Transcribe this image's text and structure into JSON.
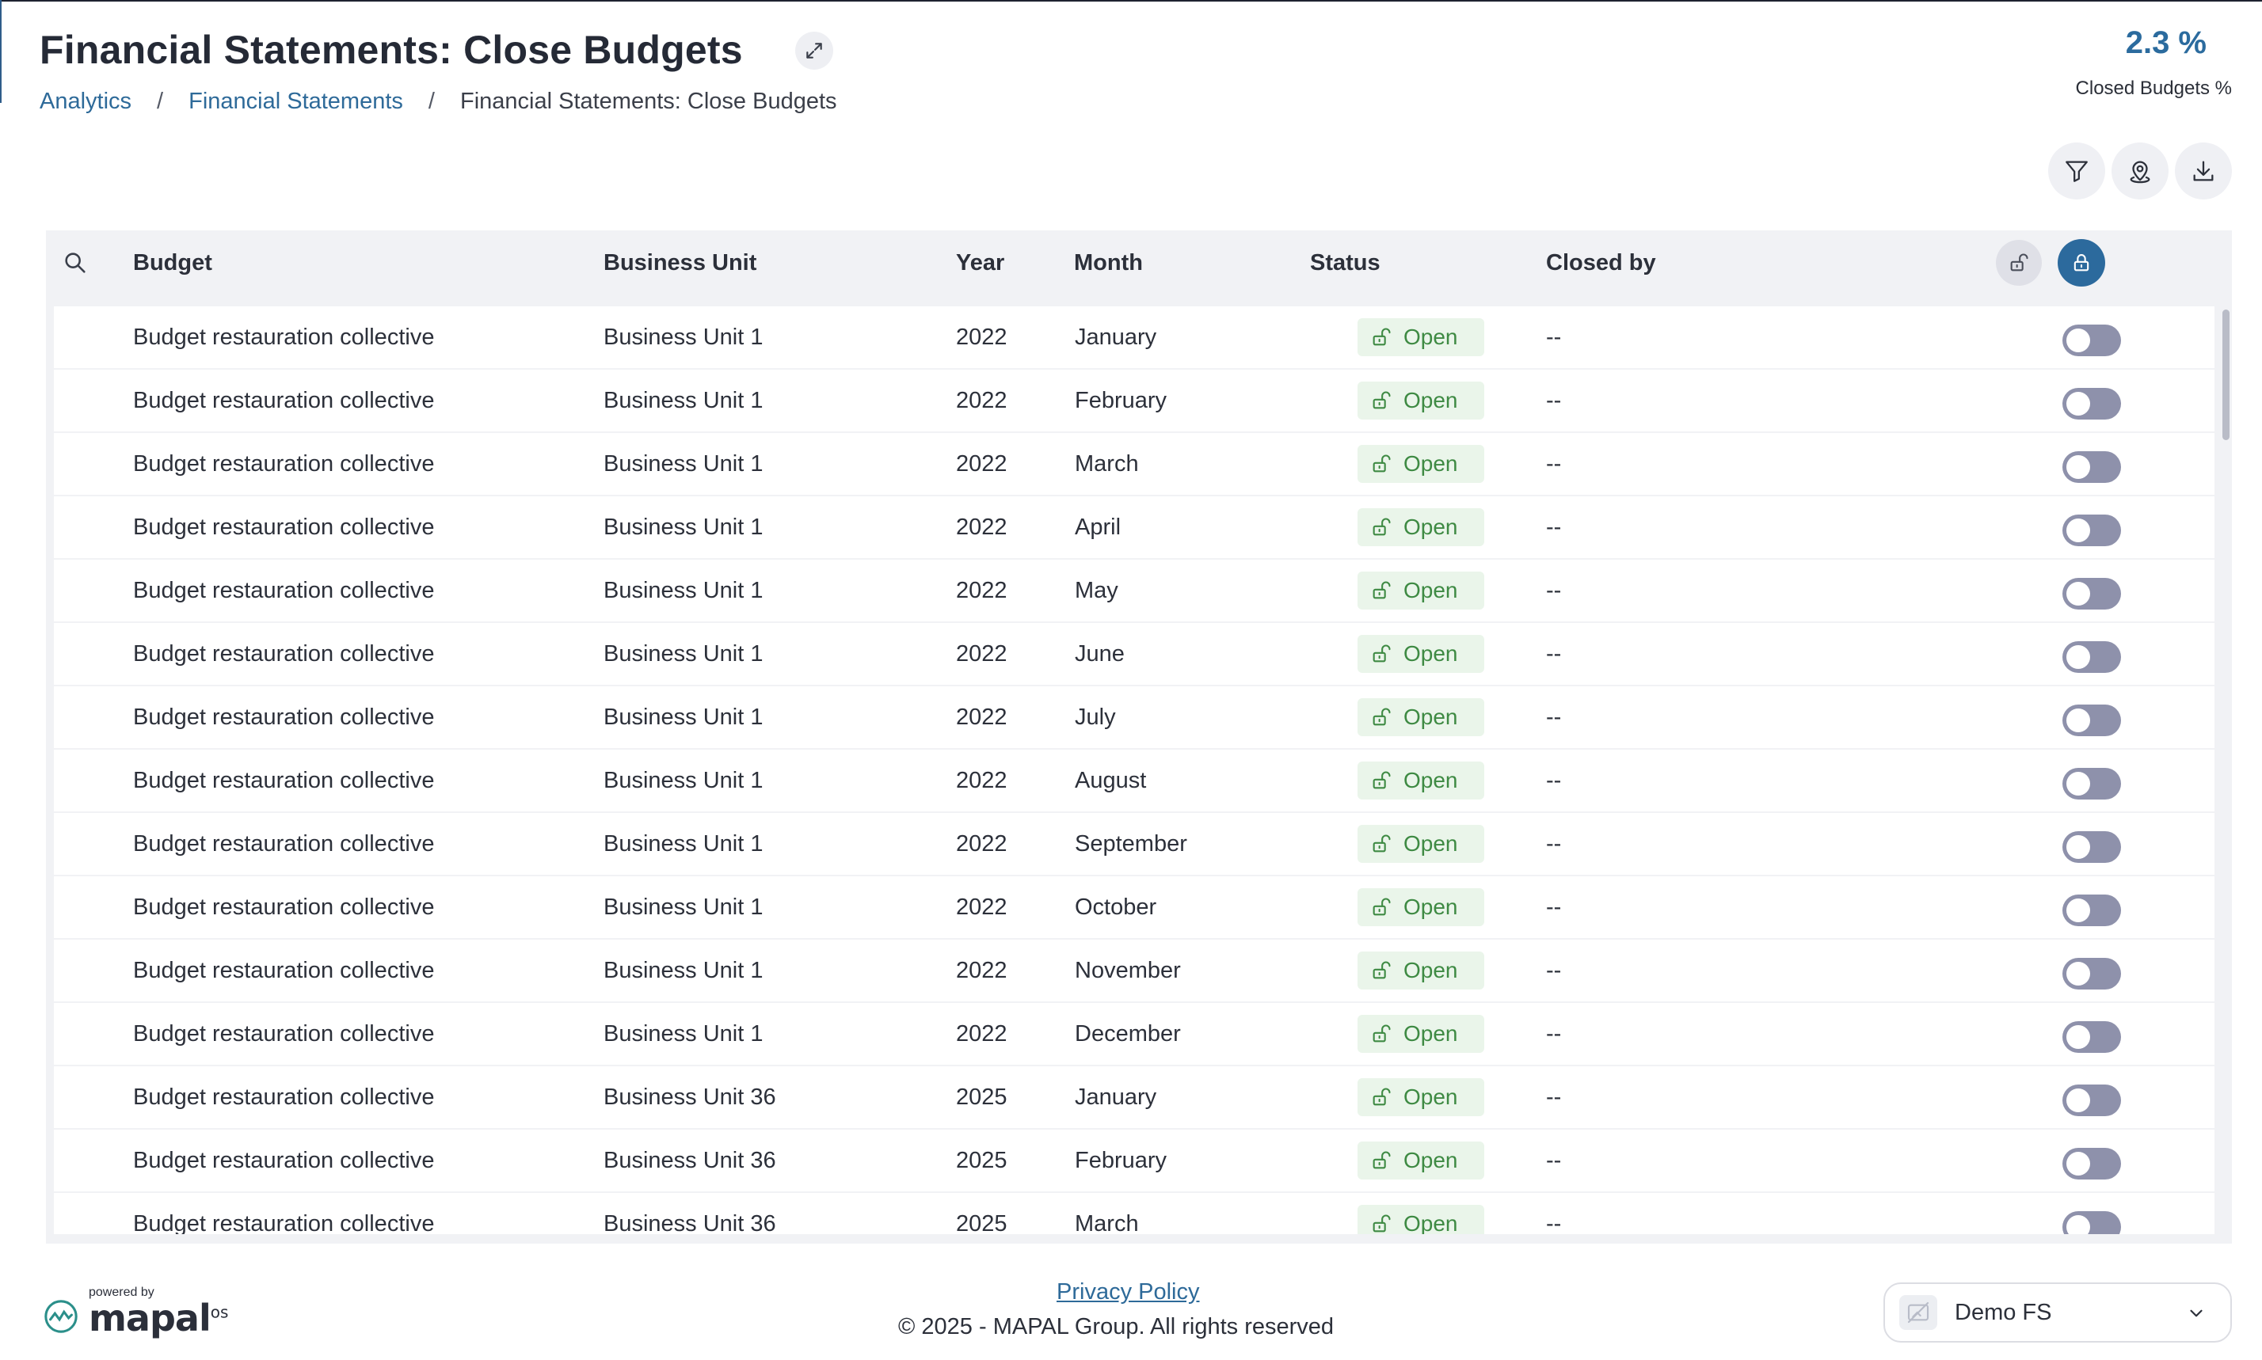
{
  "header": {
    "title": "Financial Statements: Close Budgets",
    "expand_icon": "expand-icon"
  },
  "breadcrumb": [
    {
      "label": "Analytics",
      "link": true
    },
    {
      "label": "Financial Statements",
      "link": true
    },
    {
      "label": "Financial Statements: Close Budgets",
      "link": false
    }
  ],
  "breadcrumb_separator": "/",
  "kpi": {
    "value": "2.3 %",
    "label": "Closed Budgets %"
  },
  "actions": [
    {
      "name": "filter-button",
      "icon": "filter-icon"
    },
    {
      "name": "location-button",
      "icon": "location-pin-icon"
    },
    {
      "name": "download-button",
      "icon": "download-icon"
    }
  ],
  "table": {
    "columns": {
      "budget": "Budget",
      "business_unit": "Business Unit",
      "year": "Year",
      "month": "Month",
      "status": "Status",
      "closed_by": "Closed by"
    },
    "rows": [
      {
        "budget": "Budget restauration collective",
        "business_unit": "Business Unit 1",
        "year": "2022",
        "month": "January",
        "status": "Open",
        "closed_by": "--",
        "closed": false
      },
      {
        "budget": "Budget restauration collective",
        "business_unit": "Business Unit 1",
        "year": "2022",
        "month": "February",
        "status": "Open",
        "closed_by": "--",
        "closed": false
      },
      {
        "budget": "Budget restauration collective",
        "business_unit": "Business Unit 1",
        "year": "2022",
        "month": "March",
        "status": "Open",
        "closed_by": "--",
        "closed": false
      },
      {
        "budget": "Budget restauration collective",
        "business_unit": "Business Unit 1",
        "year": "2022",
        "month": "April",
        "status": "Open",
        "closed_by": "--",
        "closed": false
      },
      {
        "budget": "Budget restauration collective",
        "business_unit": "Business Unit 1",
        "year": "2022",
        "month": "May",
        "status": "Open",
        "closed_by": "--",
        "closed": false
      },
      {
        "budget": "Budget restauration collective",
        "business_unit": "Business Unit 1",
        "year": "2022",
        "month": "June",
        "status": "Open",
        "closed_by": "--",
        "closed": false
      },
      {
        "budget": "Budget restauration collective",
        "business_unit": "Business Unit 1",
        "year": "2022",
        "month": "July",
        "status": "Open",
        "closed_by": "--",
        "closed": false
      },
      {
        "budget": "Budget restauration collective",
        "business_unit": "Business Unit 1",
        "year": "2022",
        "month": "August",
        "status": "Open",
        "closed_by": "--",
        "closed": false
      },
      {
        "budget": "Budget restauration collective",
        "business_unit": "Business Unit 1",
        "year": "2022",
        "month": "September",
        "status": "Open",
        "closed_by": "--",
        "closed": false
      },
      {
        "budget": "Budget restauration collective",
        "business_unit": "Business Unit 1",
        "year": "2022",
        "month": "October",
        "status": "Open",
        "closed_by": "--",
        "closed": false
      },
      {
        "budget": "Budget restauration collective",
        "business_unit": "Business Unit 1",
        "year": "2022",
        "month": "November",
        "status": "Open",
        "closed_by": "--",
        "closed": false
      },
      {
        "budget": "Budget restauration collective",
        "business_unit": "Business Unit 1",
        "year": "2022",
        "month": "December",
        "status": "Open",
        "closed_by": "--",
        "closed": false
      },
      {
        "budget": "Budget restauration collective",
        "business_unit": "Business Unit 36",
        "year": "2025",
        "month": "January",
        "status": "Open",
        "closed_by": "--",
        "closed": false
      },
      {
        "budget": "Budget restauration collective",
        "business_unit": "Business Unit 36",
        "year": "2025",
        "month": "February",
        "status": "Open",
        "closed_by": "--",
        "closed": false
      },
      {
        "budget": "Budget restauration collective",
        "business_unit": "Business Unit 36",
        "year": "2025",
        "month": "March",
        "status": "Open",
        "closed_by": "--",
        "closed": false
      }
    ]
  },
  "footer": {
    "powered_by": "powered by",
    "brand": "mapal",
    "brand_suffix": "os",
    "privacy_link": "Privacy Policy",
    "copyright": "© 2025 - MAPAL Group. All rights reserved",
    "company": "Demo FS"
  },
  "colors": {
    "accent": "#2c6a9d",
    "status_open_bg": "#eaf5ea",
    "status_open_text": "#3e8a43",
    "toggle_off": "#8e91ab"
  }
}
